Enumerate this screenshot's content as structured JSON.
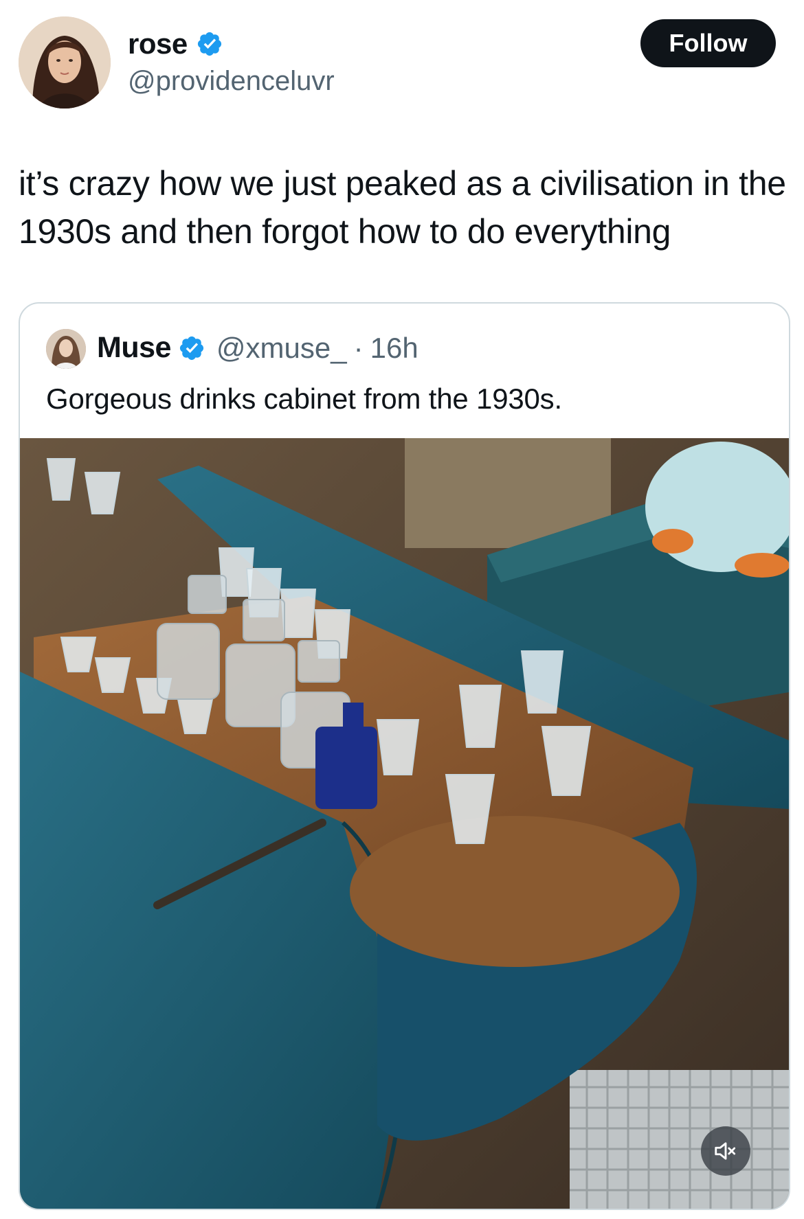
{
  "author": {
    "display_name": "rose",
    "handle": "@providenceluvr",
    "verified": true,
    "verified_icon": "verified-badge-icon"
  },
  "follow_button": {
    "label": "Follow"
  },
  "tweet": {
    "text": "it’s crazy how we just peaked as a civilisation in the 1930s and then forgot how to do everything"
  },
  "quoted_tweet": {
    "display_name": "Muse",
    "handle": "@xmuse_",
    "separator": "·",
    "time": "16h",
    "verified": true,
    "text": "Gorgeous drinks cabinet from the 1930s.",
    "media": {
      "type": "video",
      "mute_icon": "speaker-muted-icon"
    }
  },
  "colors": {
    "accent_blue": "#1d9bf0",
    "text_primary": "#0f1419",
    "text_secondary": "#536471",
    "border": "#cfd9de",
    "cabinet_teal": "#1f5f73"
  }
}
